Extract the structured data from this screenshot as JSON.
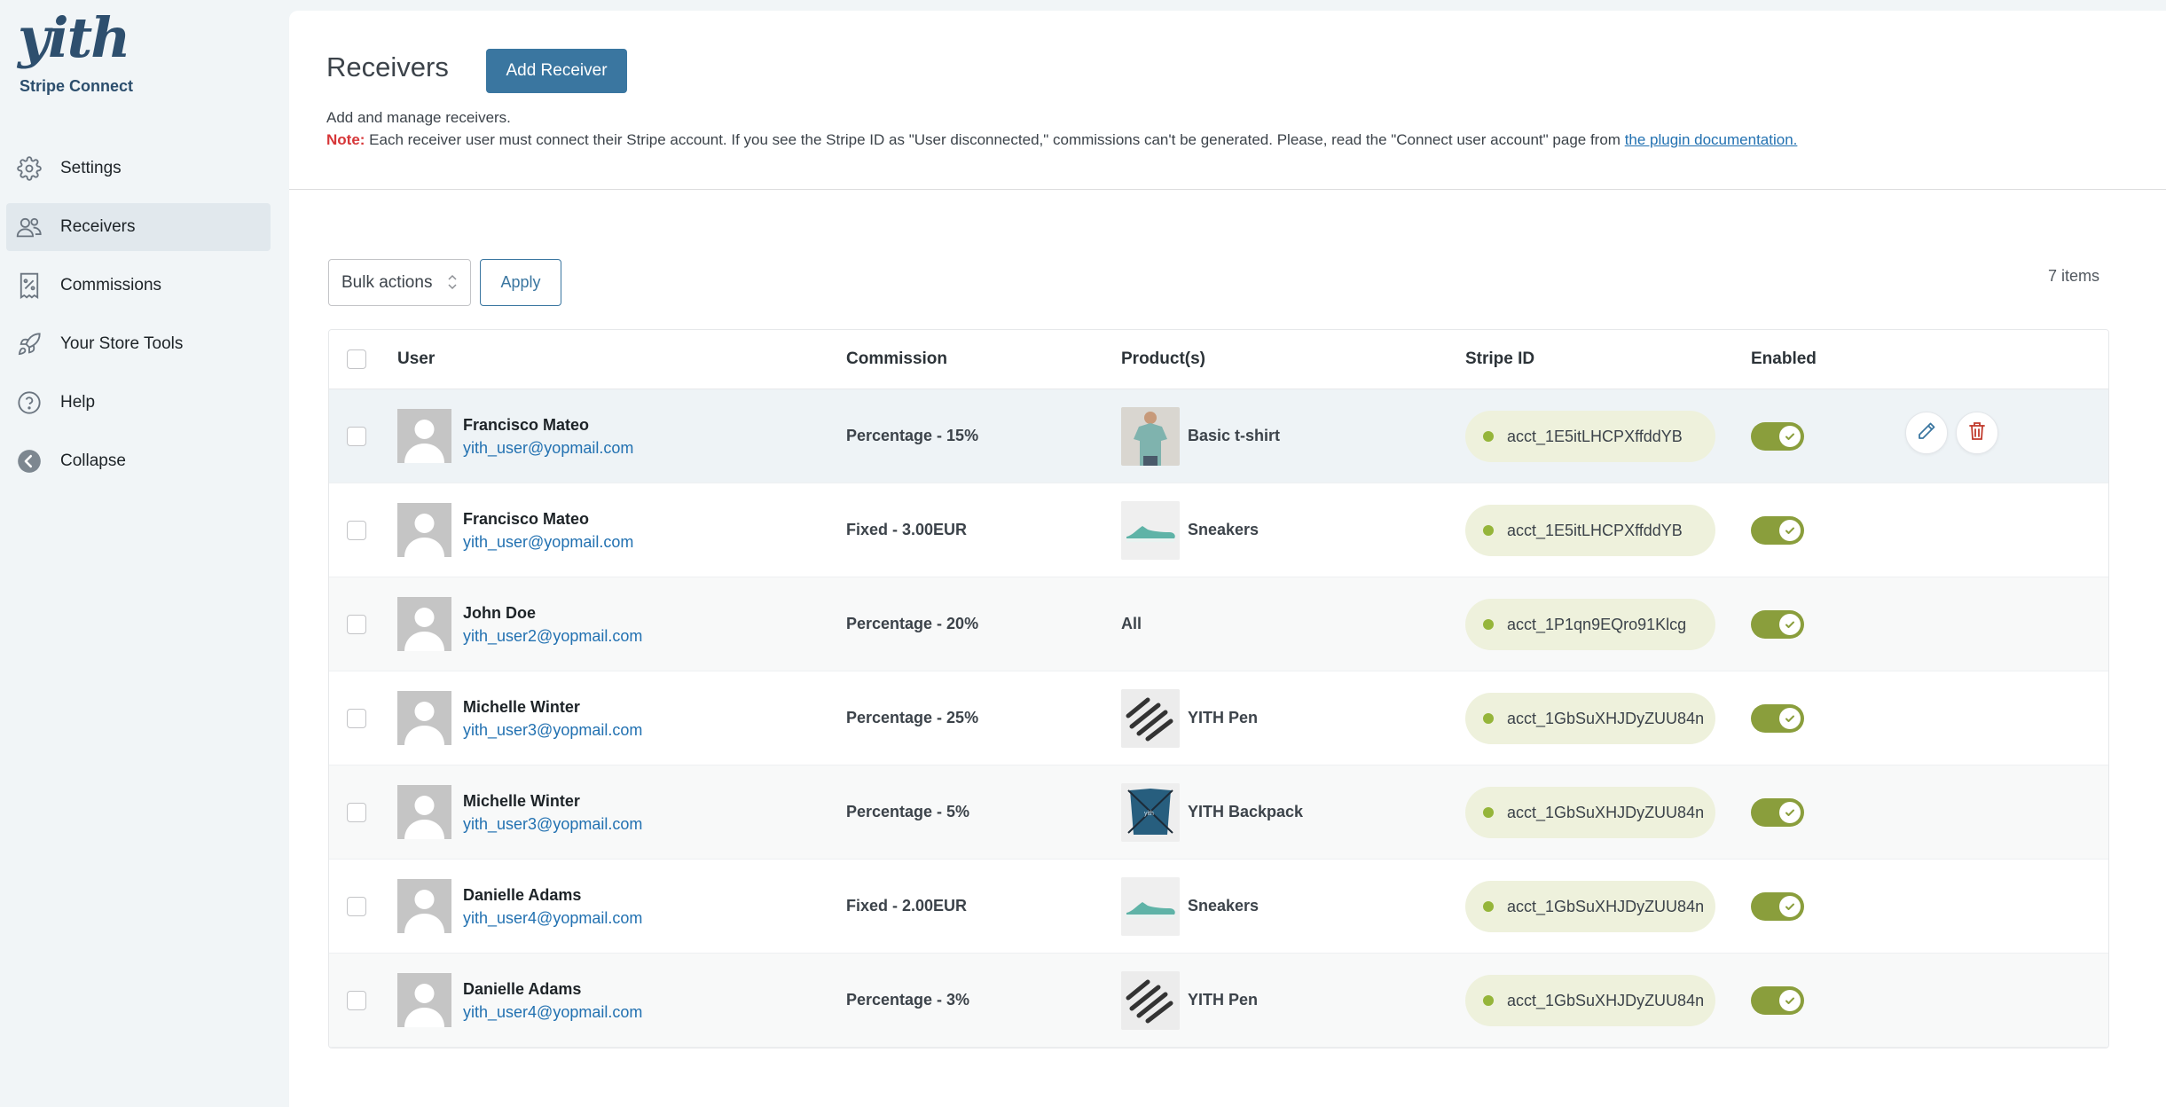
{
  "brand": {
    "logo": "yith",
    "subtitle": "Stripe Connect"
  },
  "sidebar": {
    "items": [
      {
        "label": "Settings",
        "icon": "gear-icon",
        "active": false
      },
      {
        "label": "Receivers",
        "icon": "users-icon",
        "active": true
      },
      {
        "label": "Commissions",
        "icon": "receipt-percent-icon",
        "active": false
      },
      {
        "label": "Your Store Tools",
        "icon": "rocket-icon",
        "active": false
      },
      {
        "label": "Help",
        "icon": "help-circle-icon",
        "active": false
      },
      {
        "label": "Collapse",
        "icon": "collapse-arrow-icon",
        "active": false
      }
    ]
  },
  "header": {
    "title": "Receivers",
    "add_button": "Add Receiver",
    "description": "Add and manage receivers.",
    "note_label": "Note:",
    "note_text": " Each receiver user must connect their Stripe account. If you see the Stripe ID as \"User disconnected,\" commissions can't be generated. Please, read the \"Connect user account\" page from ",
    "note_link": "the plugin documentation."
  },
  "toolbar": {
    "bulk_actions": "Bulk actions",
    "apply": "Apply",
    "items_count": "7 items"
  },
  "table": {
    "headers": {
      "user": "User",
      "commission": "Commission",
      "products": "Product(s)",
      "stripe_id": "Stripe ID",
      "enabled": "Enabled"
    },
    "rows": [
      {
        "name": "Francisco Mateo",
        "email": "yith_user@yopmail.com",
        "commission": "Percentage - 15%",
        "product": "Basic t-shirt",
        "product_image": "tshirt",
        "stripe_id": "acct_1E5itLHCPXffddYB",
        "enabled": true
      },
      {
        "name": "Francisco Mateo",
        "email": "yith_user@yopmail.com",
        "commission": "Fixed - 3.00EUR",
        "product": "Sneakers",
        "product_image": "sneaker",
        "stripe_id": "acct_1E5itLHCPXffddYB",
        "enabled": true
      },
      {
        "name": "John Doe",
        "email": "yith_user2@yopmail.com",
        "commission": "Percentage - 20%",
        "product": "All",
        "product_image": "",
        "stripe_id": "acct_1P1qn9EQro91Klcg",
        "enabled": true
      },
      {
        "name": "Michelle Winter",
        "email": "yith_user3@yopmail.com",
        "commission": "Percentage - 25%",
        "product": "YITH Pen",
        "product_image": "pen",
        "stripe_id": "acct_1GbSuXHJDyZUU84n",
        "enabled": true
      },
      {
        "name": "Michelle Winter",
        "email": "yith_user3@yopmail.com",
        "commission": "Percentage - 5%",
        "product": "YITH Backpack",
        "product_image": "backpack",
        "stripe_id": "acct_1GbSuXHJDyZUU84n",
        "enabled": true
      },
      {
        "name": "Danielle Adams",
        "email": "yith_user4@yopmail.com",
        "commission": "Fixed - 2.00EUR",
        "product": "Sneakers",
        "product_image": "sneaker",
        "stripe_id": "acct_1GbSuXHJDyZUU84n",
        "enabled": true
      },
      {
        "name": "Danielle Adams",
        "email": "yith_user4@yopmail.com",
        "commission": "Percentage - 3%",
        "product": "YITH Pen",
        "product_image": "pen",
        "stripe_id": "acct_1GbSuXHJDyZUU84n",
        "enabled": true
      }
    ]
  },
  "colors": {
    "accent": "#3a76a0",
    "toggle_on": "#8a9e3c",
    "stripe_badge": "#eef1dc",
    "status_dot": "#95b53a",
    "note": "#d63638",
    "delete": "#c0392b"
  }
}
